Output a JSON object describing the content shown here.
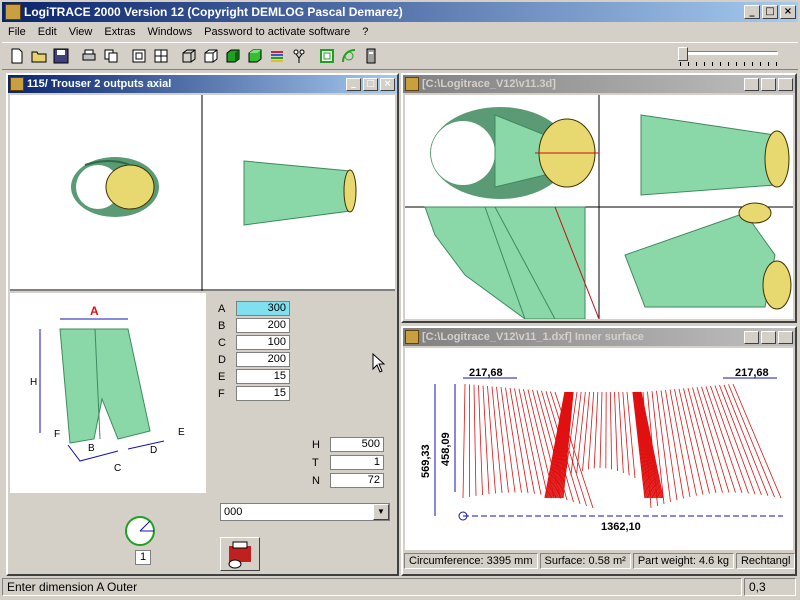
{
  "app": {
    "title": "LogiTRACE 2000  Version 12  (Copyright DEMLOG Pascal Demarez)"
  },
  "menu": [
    "File",
    "Edit",
    "View",
    "Extras",
    "Windows",
    "Password to activate software",
    "?"
  ],
  "toolbar": {
    "icons": [
      "new-file-icon",
      "open-folder-icon",
      "save-icon",
      "print-icon",
      "copy-icon",
      "single-view-icon",
      "four-views-icon",
      "wireframe-cube-icon",
      "outline-cube-icon",
      "shaded-cube-icon",
      "solid-cube-icon",
      "color-stripes-icon",
      "tree-icon",
      "frame-icon",
      "curve-icon",
      "gray-box-icon"
    ]
  },
  "window_main": {
    "title": "115/ Trouser 2 outputs axial",
    "dimensions": [
      {
        "label": "A",
        "value": "300",
        "highlight": true
      },
      {
        "label": "B",
        "value": "200"
      },
      {
        "label": "C",
        "value": "100"
      },
      {
        "label": "D",
        "value": "200"
      },
      {
        "label": "E",
        "value": "15"
      },
      {
        "label": "F",
        "value": "15"
      }
    ],
    "extra_dims": [
      {
        "label": "H",
        "value": "500"
      },
      {
        "label": "T",
        "value": "1"
      },
      {
        "label": "N",
        "value": "72"
      }
    ],
    "sketch_labels": {
      "A": "A",
      "B": "B",
      "C": "C",
      "D": "D",
      "E": "E",
      "F": "F",
      "H": "H"
    },
    "dropdown_value": "000",
    "angle_value": "1"
  },
  "window_3d": {
    "title": "[C:\\Logitrace_V12\\v11.3d]"
  },
  "window_dxf": {
    "title": "[C:\\Logitrace_V12\\v11_1.dxf]  Inner surface",
    "dims": {
      "left_top": "217,68",
      "right_top": "217,68",
      "height_outer": "569,33",
      "height_inner": "458,09",
      "width": "1362,10"
    },
    "info": {
      "circumference": "Circumference: 3395 mm",
      "surface": "Surface: 0.58 m²",
      "weight": "Part weight: 4.6 kg",
      "shape": "Rechtangl"
    }
  },
  "status": {
    "message": "Enter dimension A Outer",
    "value": "0,3"
  },
  "colors": {
    "shape_green": "#7ed0a0",
    "shape_dark": "#3e8a60",
    "inner_yellow": "#d8c850",
    "dxf_red": "#e01010",
    "dim_blue": "#1010c0",
    "titlebar_active": "#0a246a"
  }
}
